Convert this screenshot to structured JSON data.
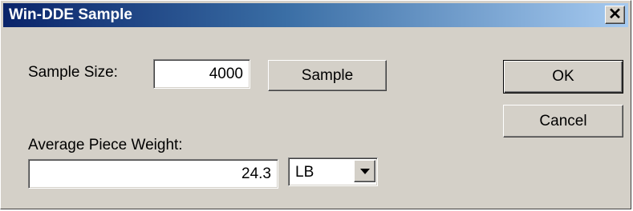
{
  "window": {
    "title": "Win-DDE Sample",
    "close_glyph": "✕",
    "titlebar_colors": [
      "#0a246a",
      "#a6caf0"
    ]
  },
  "form": {
    "sample_size_label": "Sample Size:",
    "sample_size_value": "4000",
    "sample_button_label": "Sample",
    "apw_label": "Average Piece Weight:",
    "apw_value": "24.3",
    "unit_selected": "LB"
  },
  "actions": {
    "ok_label": "OK",
    "cancel_label": "Cancel"
  }
}
